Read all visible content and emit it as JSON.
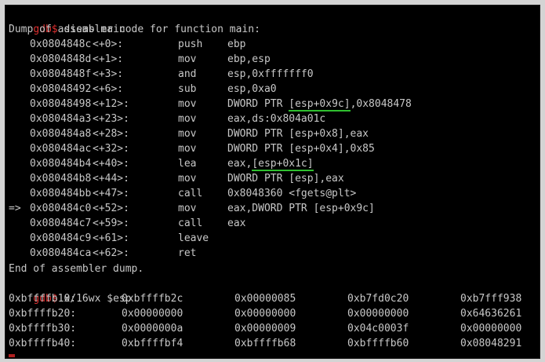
{
  "prompt": "gdb$",
  "cmd1": " disas main",
  "dump_header": "Dump of assembler code for function main:",
  "asm": [
    {
      "marker": "  ",
      "addr": "0x0804848c",
      "off": "<+0>:",
      "op": "push",
      "args": [
        {
          "t": "ebp"
        }
      ]
    },
    {
      "marker": "  ",
      "addr": "0x0804848d",
      "off": "<+1>:",
      "op": "mov",
      "args": [
        {
          "t": "ebp,esp"
        }
      ]
    },
    {
      "marker": "  ",
      "addr": "0x0804848f",
      "off": "<+3>:",
      "op": "and",
      "args": [
        {
          "t": "esp,0xfffffff0"
        }
      ]
    },
    {
      "marker": "  ",
      "addr": "0x08048492",
      "off": "<+6>:",
      "op": "sub",
      "args": [
        {
          "t": "esp,0xa0"
        }
      ]
    },
    {
      "marker": "  ",
      "addr": "0x08048498",
      "off": "<+12>:",
      "op": "mov",
      "args": [
        {
          "t": "DWORD PTR "
        },
        {
          "t": "[esp+0x9c]",
          "u": true
        },
        {
          "t": ",0x8048478"
        }
      ]
    },
    {
      "marker": "  ",
      "addr": "0x080484a3",
      "off": "<+23>:",
      "op": "mov",
      "args": [
        {
          "t": "eax,ds:0x804a01c"
        }
      ]
    },
    {
      "marker": "  ",
      "addr": "0x080484a8",
      "off": "<+28>:",
      "op": "mov",
      "args": [
        {
          "t": "DWORD PTR [esp+0x8],eax"
        }
      ]
    },
    {
      "marker": "  ",
      "addr": "0x080484ac",
      "off": "<+32>:",
      "op": "mov",
      "args": [
        {
          "t": "DWORD PTR [esp+0x4],0x85"
        }
      ]
    },
    {
      "marker": "  ",
      "addr": "0x080484b4",
      "off": "<+40>:",
      "op": "lea",
      "args": [
        {
          "t": "eax,"
        },
        {
          "t": "[esp+0x1c]",
          "u": true
        }
      ]
    },
    {
      "marker": "  ",
      "addr": "0x080484b8",
      "off": "<+44>:",
      "op": "mov",
      "args": [
        {
          "t": "DWORD PTR [esp],eax"
        }
      ]
    },
    {
      "marker": "  ",
      "addr": "0x080484bb",
      "off": "<+47>:",
      "op": "call",
      "args": [
        {
          "t": "0x8048360 <fgets@plt>"
        }
      ]
    },
    {
      "marker": "=>",
      "addr": "0x080484c0",
      "off": "<+52>:",
      "op": "mov",
      "args": [
        {
          "t": "eax,DWORD PTR [esp+0x9c]"
        }
      ]
    },
    {
      "marker": "  ",
      "addr": "0x080484c7",
      "off": "<+59>:",
      "op": "call",
      "args": [
        {
          "t": "eax"
        }
      ]
    },
    {
      "marker": "  ",
      "addr": "0x080484c9",
      "off": "<+61>:",
      "op": "leave",
      "args": []
    },
    {
      "marker": "  ",
      "addr": "0x080484ca",
      "off": "<+62>:",
      "op": "ret",
      "args": []
    }
  ],
  "dump_footer": "End of assembler dump.",
  "cmd2": " x/16wx $esp",
  "mem": [
    {
      "addr": "0xbffffb10:",
      "words": [
        "0xbffffb2c",
        "0x00000085",
        "0xb7fd0c20",
        "0xb7fff938"
      ]
    },
    {
      "addr": "0xbffffb20:",
      "words": [
        "0x00000000",
        "0x00000000",
        "0x00000000",
        "0x64636261"
      ]
    },
    {
      "addr": "0xbffffb30:",
      "words": [
        "0x0000000a",
        "0x00000009",
        "0x04c0003f",
        "0x00000000"
      ]
    },
    {
      "addr": "0xbffffb40:",
      "words": [
        "0xbffffbf4",
        "0xbffffb68",
        "0xbffffb60",
        "0x08048291"
      ]
    }
  ],
  "colors": {
    "prompt": "#e03030",
    "text": "#c8c8c8",
    "underline": "#2fbf2f",
    "background": "#000000"
  }
}
